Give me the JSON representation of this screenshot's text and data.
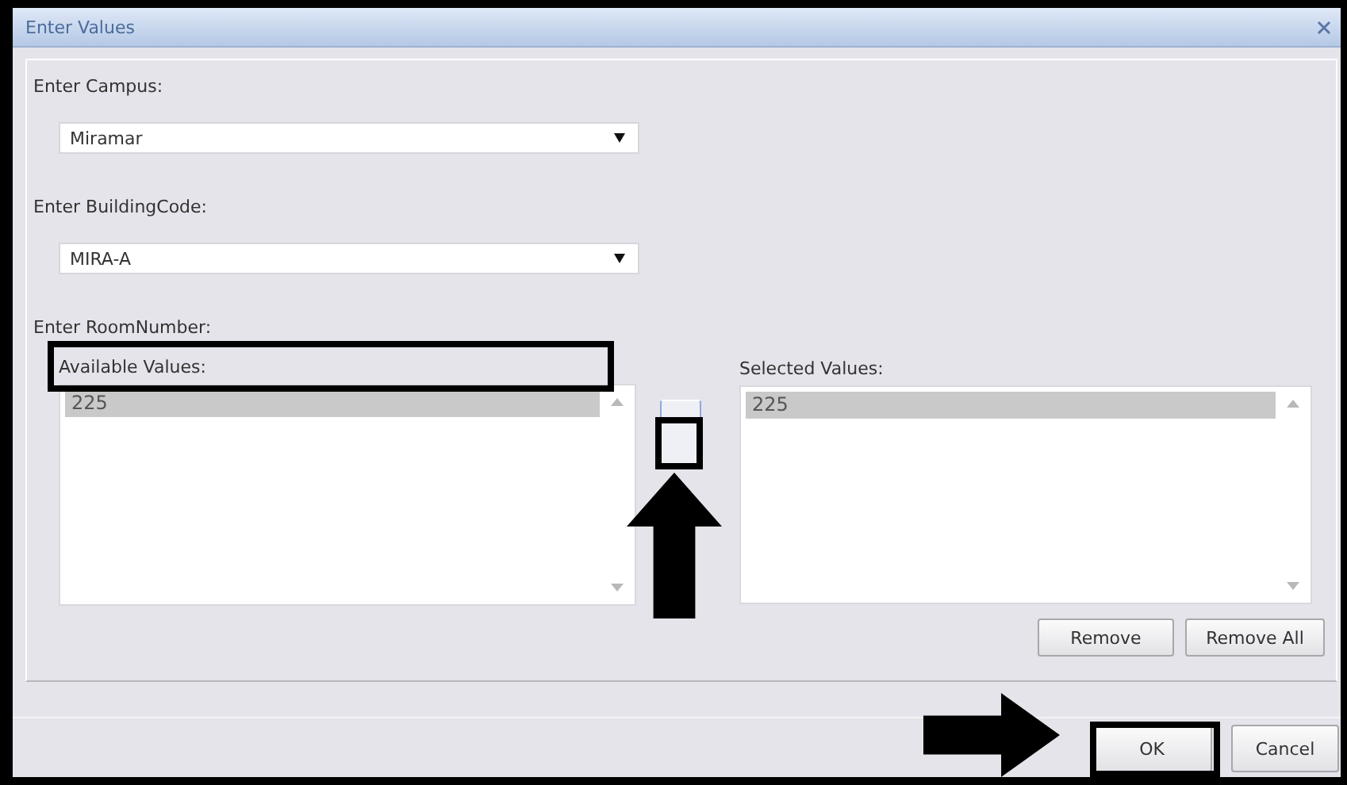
{
  "window": {
    "title": "Enter Values"
  },
  "fields": [
    {
      "label": "Enter Campus:",
      "kind": "dropdown",
      "value": "Miramar"
    },
    {
      "label": "Enter BuildingCode:",
      "kind": "dropdown",
      "value": "MIRA-A"
    }
  ],
  "room": {
    "label": "Enter RoomNumber:",
    "available": {
      "label": "Available Values:",
      "items": [
        {
          "text": "225",
          "selected": true
        }
      ]
    },
    "chosen": {
      "label": "Selected Values:",
      "items": [
        {
          "text": "225",
          "selected": true
        }
      ]
    },
    "buttons": [
      {
        "label": "Remove"
      },
      {
        "label": "Remove All"
      }
    ]
  },
  "footer_buttons": [
    {
      "label": "OK"
    },
    {
      "label": "Cancel"
    }
  ],
  "annotations": [
    {
      "kind": "box"
    },
    {
      "kind": "box"
    },
    {
      "kind": "arrow-up"
    },
    {
      "kind": "arrow-right"
    },
    {
      "kind": "box"
    }
  ]
}
